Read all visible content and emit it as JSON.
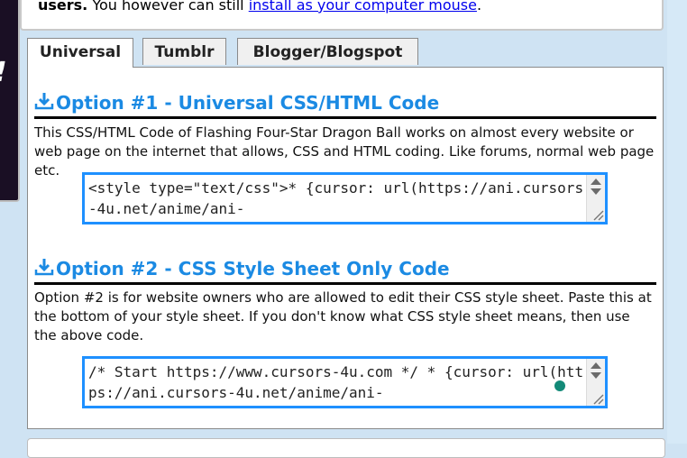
{
  "notice": {
    "bold": "users.",
    "text": " You however can still ",
    "link": "install as your computer mouse",
    "end": "."
  },
  "left_image": {
    "glyph": "!"
  },
  "tabs": [
    {
      "label": "Universal",
      "active": true
    },
    {
      "label": "Tumblr",
      "active": false
    },
    {
      "label": "Blogger/Blogspot",
      "active": false
    }
  ],
  "options": [
    {
      "title": "Option #1 - Universal CSS/HTML Code",
      "description": "This CSS/HTML Code of Flashing Four-Star Dragon Ball works on almost every website or web page on the internet that allows, CSS and HTML coding. Like forums, normal web page etc.",
      "code": "<style type=\"text/css\">* {cursor: url(https://ani.cursors-4u.net/anime/ani-"
    },
    {
      "title": "Option #2 - CSS Style Sheet Only Code",
      "description": "Option #2 is for website owners who are allowed to edit their CSS style sheet. Paste this at the bottom of your style sheet. If you don't know what CSS style sheet means, then use the above code.",
      "code": "/* Start https://www.cursors-4u.com */ * {cursor: url(https://ani.cursors-4u.net/anime/ani-"
    }
  ],
  "colors": {
    "accent": "#1b8ae3",
    "codebox_border": "#1e90ff",
    "link": "#0000ee",
    "page_bg": "#cfe3f3",
    "cursor_dot": "#138a78"
  }
}
